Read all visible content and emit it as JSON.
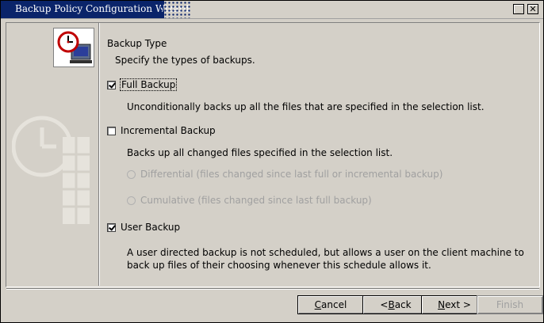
{
  "window": {
    "title": "Backup Policy Configuration Wizard"
  },
  "page": {
    "heading": "Backup Type",
    "subheading": "Specify the types of backups."
  },
  "options": {
    "full": {
      "label": "Full Backup",
      "checked": true,
      "description": "Unconditionally backs up all the files that are specified in the selection list."
    },
    "incremental": {
      "label": "Incremental Backup",
      "checked": false,
      "description": "Backs up all changed files specified in the selection list.",
      "radio_differential": "Differential (files changed since last full or incremental backup)",
      "radio_cumulative": "Cumulative (files changed since last full backup)"
    },
    "user": {
      "label": "User Backup",
      "checked": true,
      "description_line1": "A user directed backup is not scheduled, but allows a user on the client machine to",
      "description_line2": "back up files of their choosing whenever this schedule allows it."
    }
  },
  "buttons": {
    "cancel": {
      "prefix": "",
      "mnemonic": "C",
      "rest": "ancel"
    },
    "back": {
      "prefix": "< ",
      "mnemonic": "B",
      "rest": "ack"
    },
    "next": {
      "prefix": "",
      "mnemonic": "N",
      "rest": "ext >"
    },
    "finish": "Finish"
  },
  "icons": {
    "wizard": "clock-computer-icon",
    "watermark": "clock-watermark-icon"
  },
  "colors": {
    "titlebar": "#0a246a",
    "background": "#d4d0c8",
    "disabled_text": "#a0a0a0"
  }
}
